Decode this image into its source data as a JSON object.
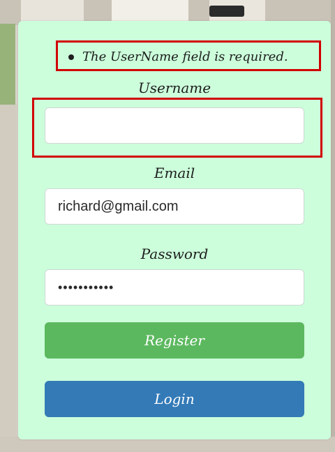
{
  "validation_error": "The UserName field is required.",
  "form": {
    "username": {
      "label": "Username",
      "value": ""
    },
    "email": {
      "label": "Email",
      "value": "richard@gmail.com"
    },
    "password": {
      "label": "Password",
      "value": "•••••••••••"
    }
  },
  "buttons": {
    "register": "Register",
    "login": "Login"
  },
  "colors": {
    "card_background": "#ccfedb",
    "register_button": "#5cb85f",
    "login_button": "#337ab7",
    "error_highlight": "#d10000"
  }
}
